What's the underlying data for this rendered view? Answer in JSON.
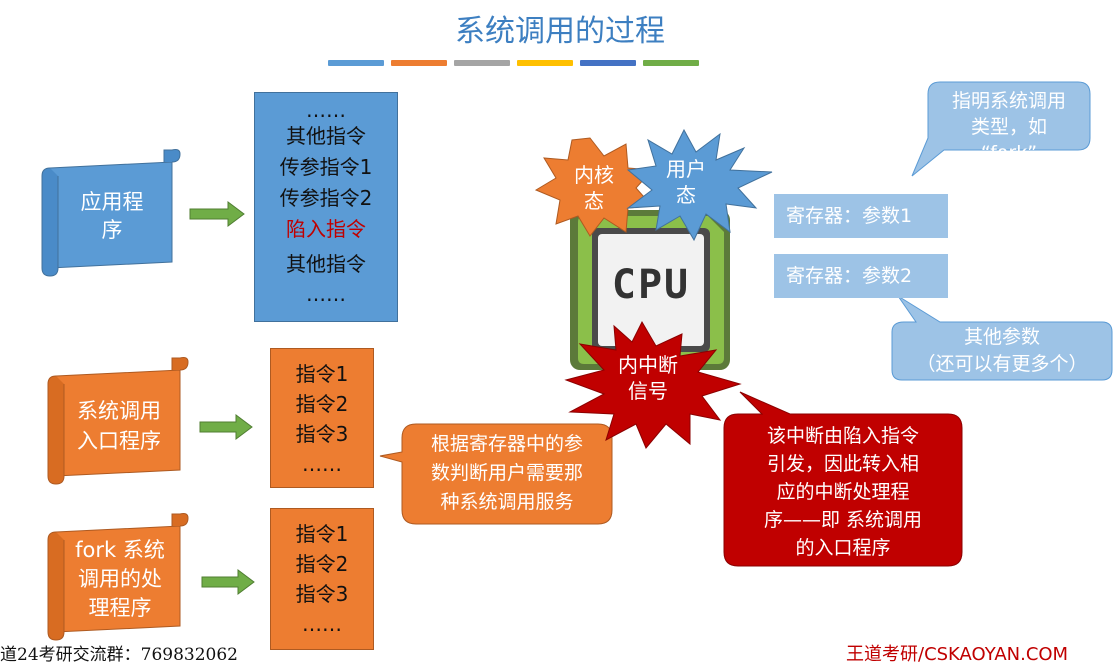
{
  "title": "系统调用的过程",
  "colors": {
    "title": "#3d7fc1",
    "bar_colors": [
      "#5b9bd5",
      "#ed7d31",
      "#a5a5a5",
      "#ffc000",
      "#4472c4",
      "#70ad47"
    ],
    "blue": "#5b9bd5",
    "orange": "#ed7d31",
    "green_arrow": "#70ad47",
    "red": "#c00000",
    "light_blue": "#9dc3e6"
  },
  "scrolls": {
    "app": "应用程序",
    "entry": [
      "系统调用",
      "入口程序"
    ],
    "fork": [
      "fork 系统",
      "调用的处",
      "理程序"
    ]
  },
  "app_instructions": [
    "……",
    "其他指令",
    "传参指令1",
    "传参指令2",
    "陷入指令",
    "其他指令",
    "……"
  ],
  "entry_instructions": [
    "指令1",
    "指令2",
    "指令3",
    "……"
  ],
  "fork_instructions": [
    "指令1",
    "指令2",
    "指令3",
    "……"
  ],
  "orange_callout": [
    "根据寄存器中的参",
    "数判断用户需要那",
    "种系统调用服务"
  ],
  "cpu": {
    "label": "CPU",
    "kernel_state": [
      "内核",
      "态"
    ],
    "user_state": [
      "用户",
      "态"
    ],
    "interrupt": [
      "内中断",
      "信号"
    ]
  },
  "red_callout": [
    "该中断由陷入指令",
    "引发，因此转入相",
    "应的中断处理程",
    "序——即 系统调用",
    "的入口程序"
  ],
  "blue_callout": [
    "指明系统调用",
    "类型，如",
    "“fork”"
  ],
  "registers": [
    "寄存器：参数1",
    "寄存器：参数2"
  ],
  "other_params": [
    "其他参数",
    "（还可以有更多个）"
  ],
  "footer_left": "道24考研交流群：769832062",
  "footer_right": "王道考研/CSKAOYAN.COM"
}
